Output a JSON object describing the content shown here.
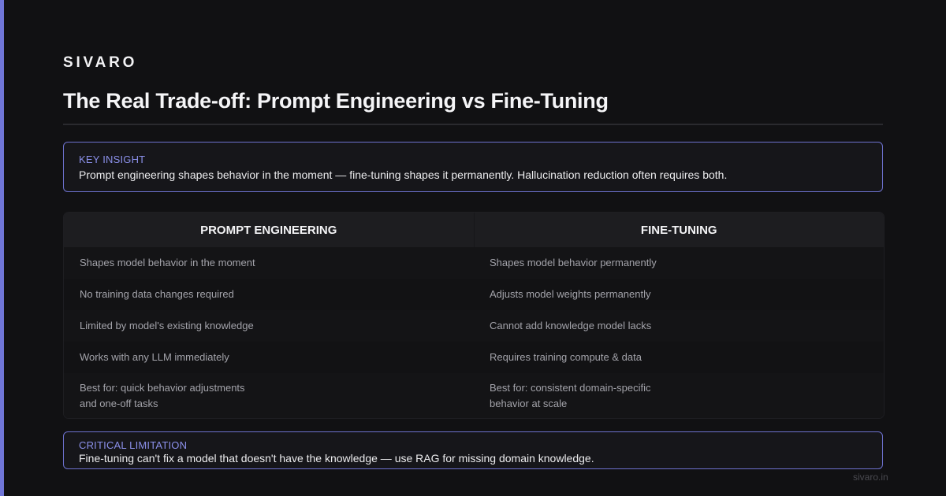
{
  "brand": "SIVARO",
  "title": "The Real Trade-off: Prompt Engineering vs Fine-Tuning",
  "key_insight": {
    "label": "KEY INSIGHT",
    "text": "Prompt engineering shapes behavior in the moment — fine-tuning shapes it permanently. Hallucination reduction often requires both."
  },
  "table": {
    "headers": [
      "PROMPT ENGINEERING",
      "FINE-TUNING"
    ],
    "rows": [
      [
        "Shapes model behavior in the moment",
        "Shapes model behavior permanently"
      ],
      [
        "No training data changes required",
        "Adjusts model weights permanently"
      ],
      [
        "Limited by model's existing knowledge",
        "Cannot add knowledge model lacks"
      ],
      [
        "Works with any LLM immediately",
        "Requires training compute & data"
      ],
      [
        "Best for: quick behavior adjustments\nand one-off tasks",
        "Best for: consistent domain-specific\nbehavior at scale"
      ]
    ]
  },
  "critical_limitation": {
    "label": "CRITICAL LIMITATION",
    "text": "Fine-tuning can't fix a model that doesn't have the knowledge — use RAG for missing domain knowledge."
  },
  "footer": {
    "url": "sivaro.in"
  },
  "colors": {
    "accent": "#7076d8",
    "background": "#111113",
    "label": "#8b90ea"
  }
}
